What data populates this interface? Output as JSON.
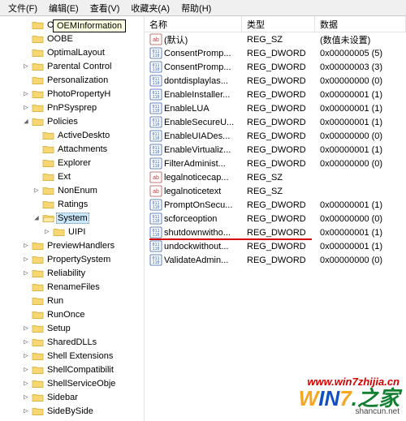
{
  "menubar": [
    "文件(F)",
    "编辑(E)",
    "查看(V)",
    "收藏夹(A)",
    "帮助(H)"
  ],
  "tooltip": "OEMInformation",
  "tree": [
    {
      "d": 2,
      "e": "",
      "l": "OEMInformation"
    },
    {
      "d": 2,
      "e": "",
      "l": "OOBE"
    },
    {
      "d": 2,
      "e": "",
      "l": "OptimalLayout"
    },
    {
      "d": 2,
      "e": "▷",
      "l": "Parental Control"
    },
    {
      "d": 2,
      "e": "",
      "l": "Personalization"
    },
    {
      "d": 2,
      "e": "▷",
      "l": "PhotoPropertyH"
    },
    {
      "d": 2,
      "e": "▷",
      "l": "PnPSysprep"
    },
    {
      "d": 2,
      "e": "◢",
      "l": "Policies"
    },
    {
      "d": 3,
      "e": "",
      "l": "ActiveDeskto"
    },
    {
      "d": 3,
      "e": "",
      "l": "Attachments"
    },
    {
      "d": 3,
      "e": "",
      "l": "Explorer"
    },
    {
      "d": 3,
      "e": "",
      "l": "Ext"
    },
    {
      "d": 3,
      "e": "▷",
      "l": "NonEnum"
    },
    {
      "d": 3,
      "e": "",
      "l": "Ratings"
    },
    {
      "d": 3,
      "e": "◢",
      "l": "System",
      "sel": true
    },
    {
      "d": 4,
      "e": "▷",
      "l": "UIPI"
    },
    {
      "d": 2,
      "e": "▷",
      "l": "PreviewHandlers"
    },
    {
      "d": 2,
      "e": "▷",
      "l": "PropertySystem"
    },
    {
      "d": 2,
      "e": "▷",
      "l": "Reliability"
    },
    {
      "d": 2,
      "e": "",
      "l": "RenameFiles"
    },
    {
      "d": 2,
      "e": "",
      "l": "Run"
    },
    {
      "d": 2,
      "e": "",
      "l": "RunOnce"
    },
    {
      "d": 2,
      "e": "▷",
      "l": "Setup"
    },
    {
      "d": 2,
      "e": "▷",
      "l": "SharedDLLs"
    },
    {
      "d": 2,
      "e": "▷",
      "l": "Shell Extensions"
    },
    {
      "d": 2,
      "e": "▷",
      "l": "ShellCompatibilit"
    },
    {
      "d": 2,
      "e": "▷",
      "l": "ShellServiceObje"
    },
    {
      "d": 2,
      "e": "▷",
      "l": "Sidebar"
    },
    {
      "d": 2,
      "e": "▷",
      "l": "SideBySide"
    }
  ],
  "columns": {
    "name": "名称",
    "type": "类型",
    "data": "数据"
  },
  "rows": [
    {
      "ico": "sz",
      "n": "(默认)",
      "t": "REG_SZ",
      "d": "(数值未设置)"
    },
    {
      "ico": "dw",
      "n": "ConsentPromp...",
      "t": "REG_DWORD",
      "d": "0x00000005 (5)"
    },
    {
      "ico": "dw",
      "n": "ConsentPromp...",
      "t": "REG_DWORD",
      "d": "0x00000003 (3)"
    },
    {
      "ico": "dw",
      "n": "dontdisplaylas...",
      "t": "REG_DWORD",
      "d": "0x00000000 (0)"
    },
    {
      "ico": "dw",
      "n": "EnableInstaller...",
      "t": "REG_DWORD",
      "d": "0x00000001 (1)"
    },
    {
      "ico": "dw",
      "n": "EnableLUA",
      "t": "REG_DWORD",
      "d": "0x00000001 (1)"
    },
    {
      "ico": "dw",
      "n": "EnableSecureU...",
      "t": "REG_DWORD",
      "d": "0x00000001 (1)"
    },
    {
      "ico": "dw",
      "n": "EnableUIADes...",
      "t": "REG_DWORD",
      "d": "0x00000000 (0)"
    },
    {
      "ico": "dw",
      "n": "EnableVirtualiz...",
      "t": "REG_DWORD",
      "d": "0x00000001 (1)"
    },
    {
      "ico": "dw",
      "n": "FilterAdminist...",
      "t": "REG_DWORD",
      "d": "0x00000000 (0)"
    },
    {
      "ico": "sz",
      "n": "legalnoticecap...",
      "t": "REG_SZ",
      "d": ""
    },
    {
      "ico": "sz",
      "n": "legalnoticetext",
      "t": "REG_SZ",
      "d": ""
    },
    {
      "ico": "dw",
      "n": "PromptOnSecu...",
      "t": "REG_DWORD",
      "d": "0x00000001 (1)"
    },
    {
      "ico": "dw",
      "n": "scforceoption",
      "t": "REG_DWORD",
      "d": "0x00000000 (0)"
    },
    {
      "ico": "dw",
      "n": "shutdownwitho...",
      "t": "REG_DWORD",
      "d": "0x00000001 (1)",
      "mark": true
    },
    {
      "ico": "dw",
      "n": "undockwithout...",
      "t": "REG_DWORD",
      "d": "0x00000001 (1)"
    },
    {
      "ico": "dw",
      "n": "ValidateAdmin...",
      "t": "REG_DWORD",
      "d": "0x00000000 (0)"
    }
  ],
  "watermark": {
    "url": "www.win7zhijia.cn",
    "logo_p1": "W",
    "logo_p2": "IN",
    "logo_p3": "7",
    "logo_p4": ".之家",
    "sub": "shancun.net"
  }
}
